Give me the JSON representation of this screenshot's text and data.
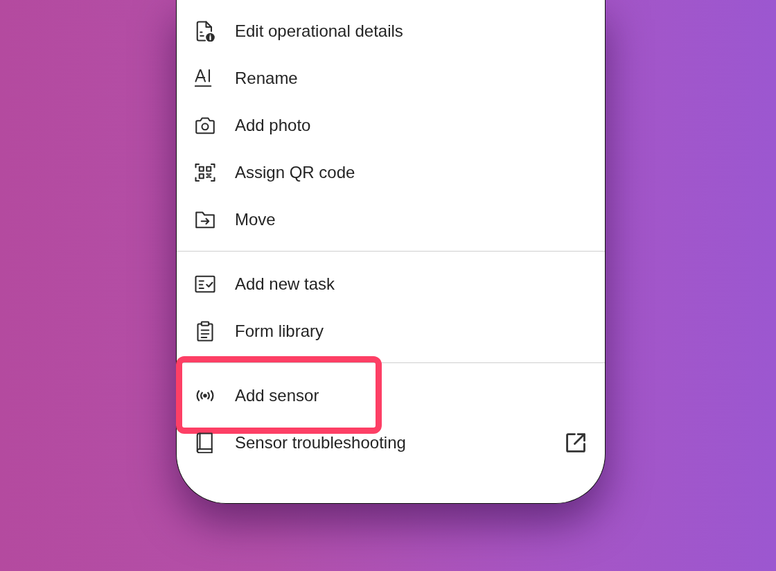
{
  "menu": {
    "sections": [
      {
        "items": [
          {
            "label": "Edit operational details",
            "highlighted": false,
            "external": false
          },
          {
            "label": "Rename",
            "highlighted": false,
            "external": false
          },
          {
            "label": "Add photo",
            "highlighted": false,
            "external": false
          },
          {
            "label": "Assign QR code",
            "highlighted": false,
            "external": false
          },
          {
            "label": "Move",
            "highlighted": false,
            "external": false
          }
        ]
      },
      {
        "items": [
          {
            "label": "Add new task",
            "highlighted": false,
            "external": false
          },
          {
            "label": "Form library",
            "highlighted": false,
            "external": false
          }
        ]
      },
      {
        "items": [
          {
            "label": "Add sensor",
            "highlighted": true,
            "external": false
          },
          {
            "label": "Sensor troubleshooting",
            "highlighted": false,
            "external": true
          }
        ]
      }
    ]
  }
}
